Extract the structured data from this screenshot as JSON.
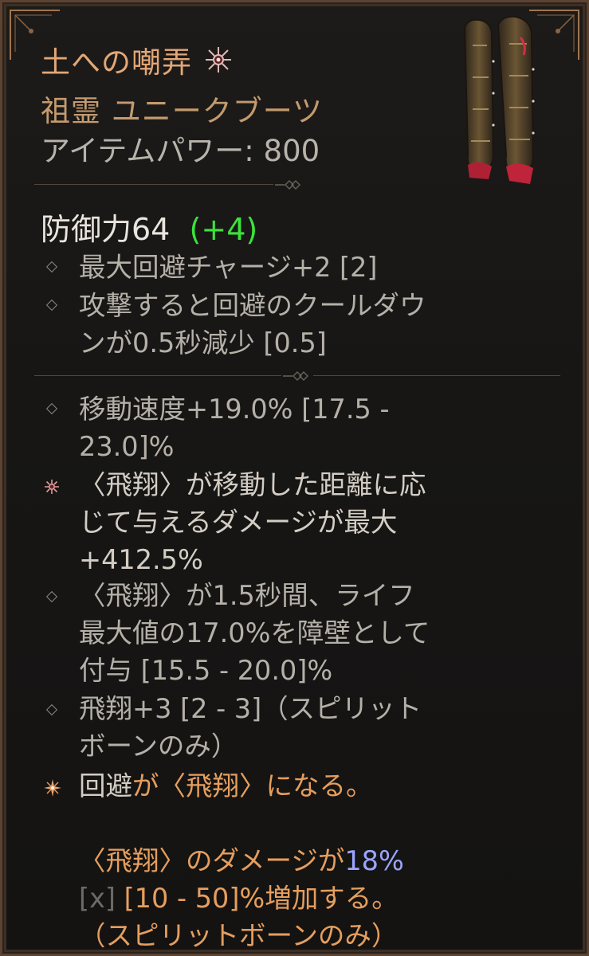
{
  "item": {
    "name": "土への嘲弄",
    "type": "祖霊 ユニークブーツ",
    "power_label": "アイテムパワー: ",
    "power_value": "800"
  },
  "armor": {
    "label": "防御力64",
    "bonus": "(+4)"
  },
  "implicits": [
    {
      "lines": [
        "最大回避チャージ+2 [2]"
      ]
    },
    {
      "lines": [
        "攻撃すると回避のクールダウ",
        "ンが0.5秒減少 [0.5]"
      ]
    }
  ],
  "affixes": [
    {
      "icon": "diamond-bullet-icon",
      "lines": [
        "移動速度+19.0% [17.5 -",
        "23.0]%"
      ]
    },
    {
      "icon": "rune-star-icon",
      "lines": [
        "〈飛翔〉が移動した距離に応",
        "じて与えるダメージが最大",
        "+412.5%"
      ]
    },
    {
      "icon": "diamond-bullet-icon",
      "lines": [
        "〈飛翔〉が1.5秒間、ライフ",
        "最大値の17.0%を障壁として",
        "付与 [15.5 - 20.0]%"
      ]
    },
    {
      "icon": "diamond-bullet-icon",
      "lines": [
        "飛翔+3 [2 - 3]（スピリット",
        "ボーンのみ）"
      ]
    }
  ],
  "unique_power": {
    "icon": "unique-star-icon",
    "line1_a": "回避",
    "line1_b": "が〈飛翔〉になる。",
    "line2_a": "〈飛翔〉のダメージが",
    "line2_value": "18%",
    "line3_x": "[x]",
    "line3_rest": " [10 - 50]%増加する。",
    "line4": "（スピリットボーンのみ）"
  },
  "colors": {
    "name": "#e2a776",
    "type": "#c49a6f",
    "bonus_green": "#3be33b",
    "unique_orange": "#e59e5e",
    "value_blue": "#9ba4ff"
  }
}
